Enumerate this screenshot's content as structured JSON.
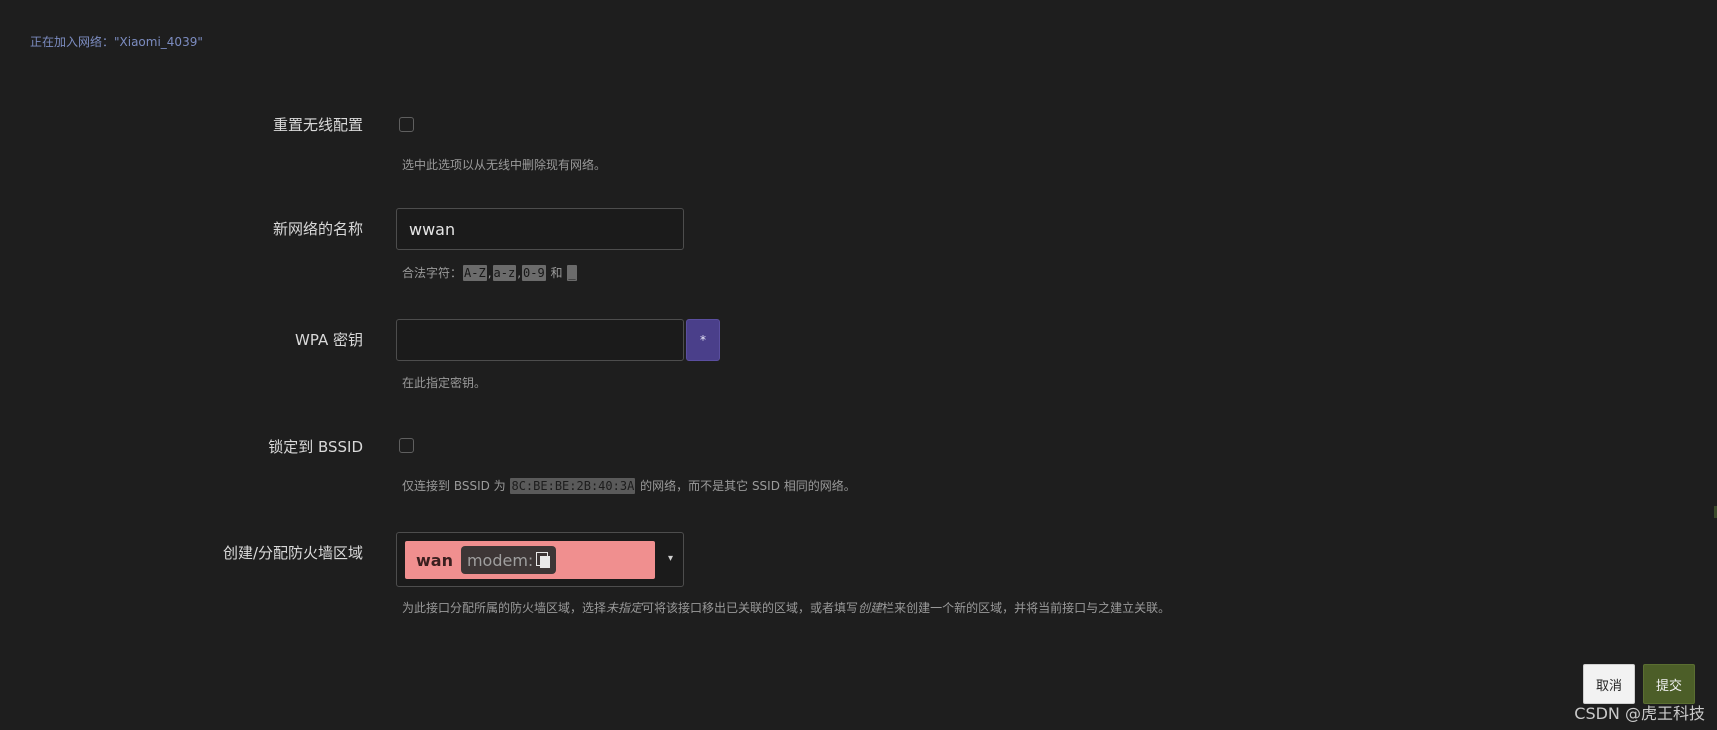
{
  "status": {
    "joining_text": "正在加入网络：\"Xiaomi_4039\""
  },
  "form": {
    "reset_wireless": {
      "label": "重置无线配置",
      "checked": false,
      "hint": "选中此选项以从无线中删除现有网络。"
    },
    "network_name": {
      "label": "新网络的名称",
      "value": "wwan",
      "hint_prefix": "合法字符：",
      "hint_codes": [
        "A-Z",
        "a-z",
        "0-9",
        "_"
      ],
      "hint_sep": ",",
      "hint_and": " 和 "
    },
    "wpa_key": {
      "label": "WPA 密钥",
      "value": "",
      "reveal_glyph": "*",
      "hint": "在此指定密钥。"
    },
    "lock_bssid": {
      "label": "锁定到 BSSID",
      "checked": false,
      "hint_prefix": "仅连接到 BSSID 为 ",
      "bssid": "8C:BE:BE:2B:40:3A",
      "hint_suffix": " 的网络，而不是其它 SSID 相同的网络。"
    },
    "firewall_zone": {
      "label": "创建/分配防火墙区域",
      "zone": "wan",
      "interface": "modem:",
      "interface_icon": "copy-icon",
      "caret": "▾",
      "hint_part1": "为此接口分配所属的防火墙区域，选择",
      "hint_em1": "未指定",
      "hint_part2": "可将该接口移出已关联的区域，或者填写",
      "hint_em2": "创建",
      "hint_part3": "栏来创建一个新的区域，并将当前接口与之建立关联。"
    }
  },
  "buttons": {
    "cancel": "取消",
    "submit": "提交"
  },
  "watermark": "CSDN @虎王科技",
  "colors": {
    "background": "#1e1e1e",
    "zone_wan": "#f08f8f",
    "submit": "#4c5e28",
    "reveal": "#4a3f8a"
  }
}
